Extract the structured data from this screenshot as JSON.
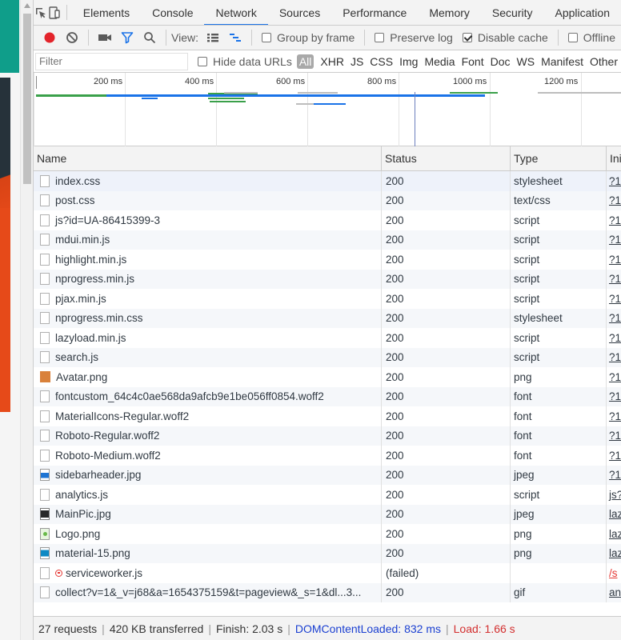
{
  "tabs": [
    "Elements",
    "Console",
    "Network",
    "Sources",
    "Performance",
    "Memory",
    "Security",
    "Application"
  ],
  "active_tab": "Network",
  "toolbar": {
    "view_label": "View:",
    "group_by_frame": "Group by frame",
    "preserve_log": "Preserve log",
    "disable_cache": "Disable cache",
    "offline": "Offline"
  },
  "filter": {
    "placeholder": "Filter",
    "hide_data_urls": "Hide data URLs",
    "types": [
      "All",
      "XHR",
      "JS",
      "CSS",
      "Img",
      "Media",
      "Font",
      "Doc",
      "WS",
      "Manifest",
      "Other"
    ]
  },
  "overview": {
    "ticks": [
      "200 ms",
      "400 ms",
      "600 ms",
      "800 ms",
      "1000 ms",
      "1200 ms"
    ]
  },
  "columns": [
    "Name",
    "Status",
    "Type",
    "Initiator"
  ],
  "rows": [
    {
      "name": "index.css",
      "status": "200",
      "type": "stylesheet",
      "initiator": "?1",
      "icon": "file"
    },
    {
      "name": "post.css",
      "status": "200",
      "type": "text/css",
      "initiator": "?1",
      "icon": "file"
    },
    {
      "name": "js?id=UA-86415399-3",
      "status": "200",
      "type": "script",
      "initiator": "?1",
      "icon": "file"
    },
    {
      "name": "mdui.min.js",
      "status": "200",
      "type": "script",
      "initiator": "?1",
      "icon": "file"
    },
    {
      "name": "highlight.min.js",
      "status": "200",
      "type": "script",
      "initiator": "?1",
      "icon": "file"
    },
    {
      "name": "nprogress.min.js",
      "status": "200",
      "type": "script",
      "initiator": "?1",
      "icon": "file"
    },
    {
      "name": "pjax.min.js",
      "status": "200",
      "type": "script",
      "initiator": "?1",
      "icon": "file"
    },
    {
      "name": "nprogress.min.css",
      "status": "200",
      "type": "stylesheet",
      "initiator": "?1",
      "icon": "file"
    },
    {
      "name": "lazyload.min.js",
      "status": "200",
      "type": "script",
      "initiator": "?1",
      "icon": "file"
    },
    {
      "name": "search.js",
      "status": "200",
      "type": "script",
      "initiator": "?1",
      "icon": "file"
    },
    {
      "name": "Avatar.png",
      "status": "200",
      "type": "png",
      "initiator": "?1",
      "icon": "png-orange"
    },
    {
      "name": "fontcustom_64c4c0ae568da9afcb9e1be056ff0854.woff2",
      "status": "200",
      "type": "font",
      "initiator": "?1",
      "icon": "file"
    },
    {
      "name": "MaterialIcons-Regular.woff2",
      "status": "200",
      "type": "font",
      "initiator": "?1",
      "icon": "file"
    },
    {
      "name": "Roboto-Regular.woff2",
      "status": "200",
      "type": "font",
      "initiator": "?1",
      "icon": "file"
    },
    {
      "name": "Roboto-Medium.woff2",
      "status": "200",
      "type": "font",
      "initiator": "?1",
      "icon": "file"
    },
    {
      "name": "sidebarheader.jpg",
      "status": "200",
      "type": "jpeg",
      "initiator": "?1",
      "icon": "img-blue"
    },
    {
      "name": "analytics.js",
      "status": "200",
      "type": "script",
      "initiator": "js?",
      "icon": "file"
    },
    {
      "name": "MainPic.jpg",
      "status": "200",
      "type": "jpeg",
      "initiator": "laz",
      "icon": "img-dark"
    },
    {
      "name": "Logo.png",
      "status": "200",
      "type": "png",
      "initiator": "laz",
      "icon": "img-logo"
    },
    {
      "name": "material-15.png",
      "status": "200",
      "type": "png",
      "initiator": "laz",
      "icon": "img-mat"
    },
    {
      "name": "serviceworker.js",
      "status": "(failed)",
      "type": "",
      "initiator": "/s",
      "icon": "file",
      "failed": true
    },
    {
      "name": "collect?v=1&_v=j68&a=1654375159&t=pageview&_s=1&dl...3...",
      "status": "200",
      "type": "gif",
      "initiator": "an",
      "icon": "file"
    }
  ],
  "status_bar": {
    "requests": "27 requests",
    "transferred": "420 KB transferred",
    "finish": "Finish: 2.03 s",
    "dom_content_loaded": "DOMContentLoaded: 832 ms",
    "load": "Load: 1.66 s"
  },
  "colors": {
    "accent": "#1a73e8",
    "record": "#e3242b",
    "dom_blue": "#1a3fd1",
    "load_red": "#d32f2f"
  }
}
